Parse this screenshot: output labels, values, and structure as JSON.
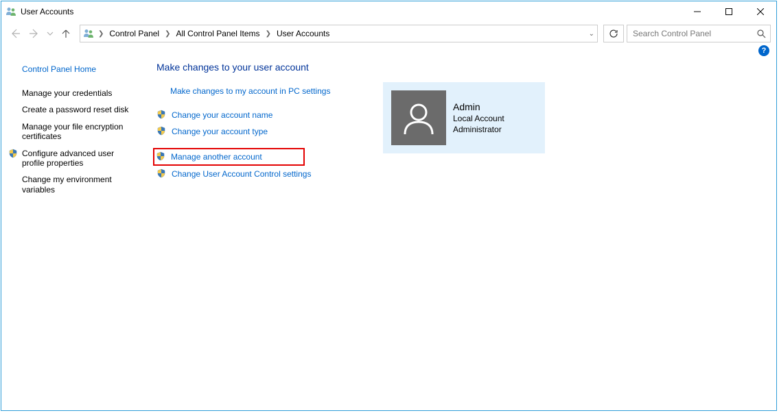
{
  "window": {
    "title": "User Accounts"
  },
  "breadcrumb": {
    "parts": [
      "Control Panel",
      "All Control Panel Items",
      "User Accounts"
    ]
  },
  "search": {
    "placeholder": "Search Control Panel"
  },
  "sidebar": {
    "home": "Control Panel Home",
    "items": [
      {
        "label": "Manage your credentials",
        "shield": false
      },
      {
        "label": "Create a password reset disk",
        "shield": false
      },
      {
        "label": "Manage your file encryption certificates",
        "shield": false
      },
      {
        "label": "Configure advanced user profile properties",
        "shield": true
      },
      {
        "label": "Change my environment variables",
        "shield": false
      }
    ]
  },
  "heading": "Make changes to your user account",
  "actions": {
    "pc_settings": "Make changes to my account in PC settings",
    "change_name": "Change your account name",
    "change_type": "Change your account type",
    "manage_another": "Manage another account",
    "uac": "Change User Account Control settings"
  },
  "account": {
    "name": "Admin",
    "type": "Local Account",
    "role": "Administrator"
  },
  "help_glyph": "?"
}
